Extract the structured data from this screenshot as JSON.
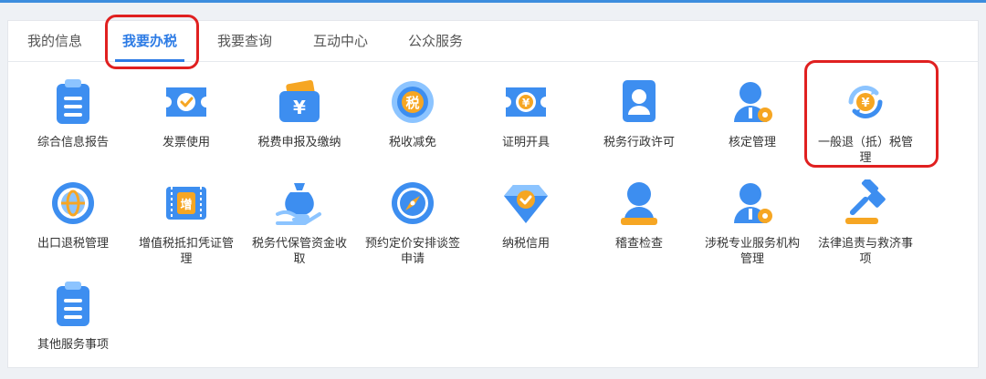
{
  "tabs": [
    {
      "label": "我的信息"
    },
    {
      "label": "我要办税"
    },
    {
      "label": "我要查询"
    },
    {
      "label": "互动中心"
    },
    {
      "label": "公众服务"
    }
  ],
  "services": [
    {
      "label": "综合信息报告",
      "icon": "clipboard-icon"
    },
    {
      "label": "发票使用",
      "icon": "invoice-ticket-icon"
    },
    {
      "label": "税费申报及缴纳",
      "icon": "wallet-yuan-icon"
    },
    {
      "label": "税收减免",
      "icon": "tax-coin-icon"
    },
    {
      "label": "证明开具",
      "icon": "certificate-yuan-icon"
    },
    {
      "label": "税务行政许可",
      "icon": "id-card-icon"
    },
    {
      "label": "核定管理",
      "icon": "user-gear-icon"
    },
    {
      "label": "一般退（抵）税管理",
      "icon": "refund-cycle-icon"
    },
    {
      "label": "出口退税管理",
      "icon": "globe-icon"
    },
    {
      "label": "增值税抵扣凭证管理",
      "icon": "vat-voucher-icon"
    },
    {
      "label": "税务代保管资金收取",
      "icon": "money-bag-hand-icon"
    },
    {
      "label": "预约定价安排谈签申请",
      "icon": "compass-icon"
    },
    {
      "label": "纳税信用",
      "icon": "diamond-check-icon"
    },
    {
      "label": "稽查检查",
      "icon": "inspector-icon"
    },
    {
      "label": "涉税专业服务机构管理",
      "icon": "user-gear-icon"
    },
    {
      "label": "法律追责与救济事项",
      "icon": "gavel-icon"
    },
    {
      "label": "其他服务事项",
      "icon": "clipboard-icon"
    }
  ],
  "colors": {
    "accent": "#2c7be5",
    "icon_blue": "#3d8ef0",
    "icon_light": "#8cc4ff",
    "icon_orange": "#f6a623",
    "highlight_red": "#e02020"
  },
  "icon_glyphs": {
    "yuan": "¥",
    "tax": "税",
    "vat": "增"
  }
}
